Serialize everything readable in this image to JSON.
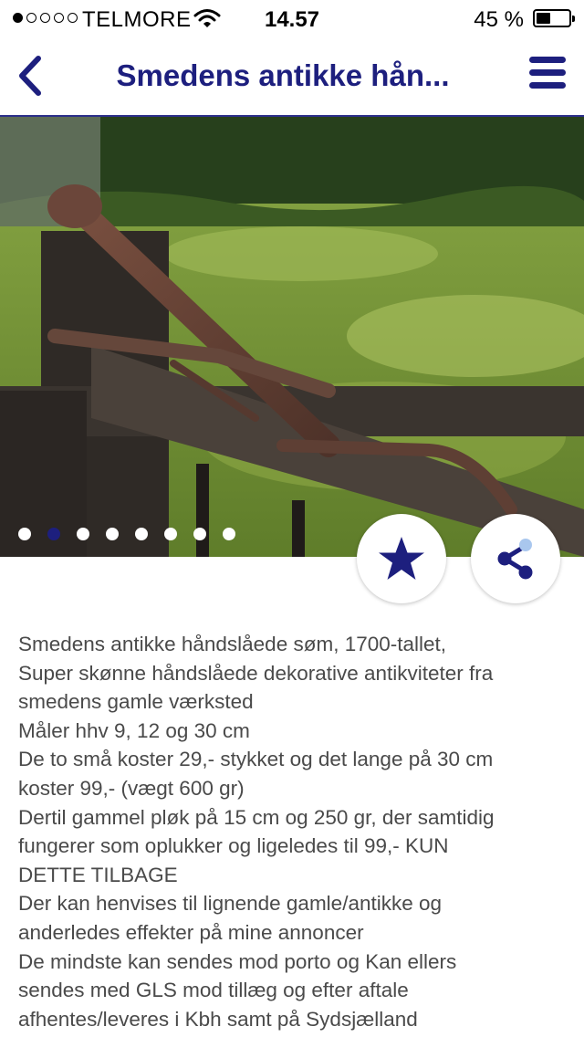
{
  "status_bar": {
    "carrier": "TELMORE",
    "time": "14.57",
    "battery_percent": "45 %",
    "battery_level": 0.45,
    "signal_bars_filled": 1,
    "signal_bars_total": 5
  },
  "nav": {
    "title": "Smedens antikke hån...",
    "back_icon": "chevron-left-icon",
    "menu_icon": "hamburger-menu-icon",
    "accent_color": "#1d1f7e"
  },
  "gallery": {
    "image_count": 8,
    "active_index": 1,
    "favorite_icon": "star-icon",
    "share_icon": "share-icon"
  },
  "description": {
    "lines": [
      "Smedens antikke håndslåede søm, 1700-tallet,",
      "Super skønne håndslåede dekorative antikviteter fra",
      "smedens gamle værksted",
      "Måler hhv 9, 12 og 30 cm",
      "De to små koster 29,- stykket og det lange på 30 cm",
      "koster 99,- (vægt 600 gr)",
      "Dertil gammel pløk på 15 cm og 250 gr, der samtidig",
      "fungerer som oplukker og ligeledes til 99,- KUN",
      "DETTE TILBAGE",
      "Der kan henvises til lignende gamle/antikke og",
      "anderledes effekter på mine annoncer",
      "De mindste kan sendes mod porto og Kan ellers",
      "sendes med GLS mod tillæg og efter aftale",
      "afhentes/leveres i Kbh samt på Sydsjælland"
    ]
  }
}
